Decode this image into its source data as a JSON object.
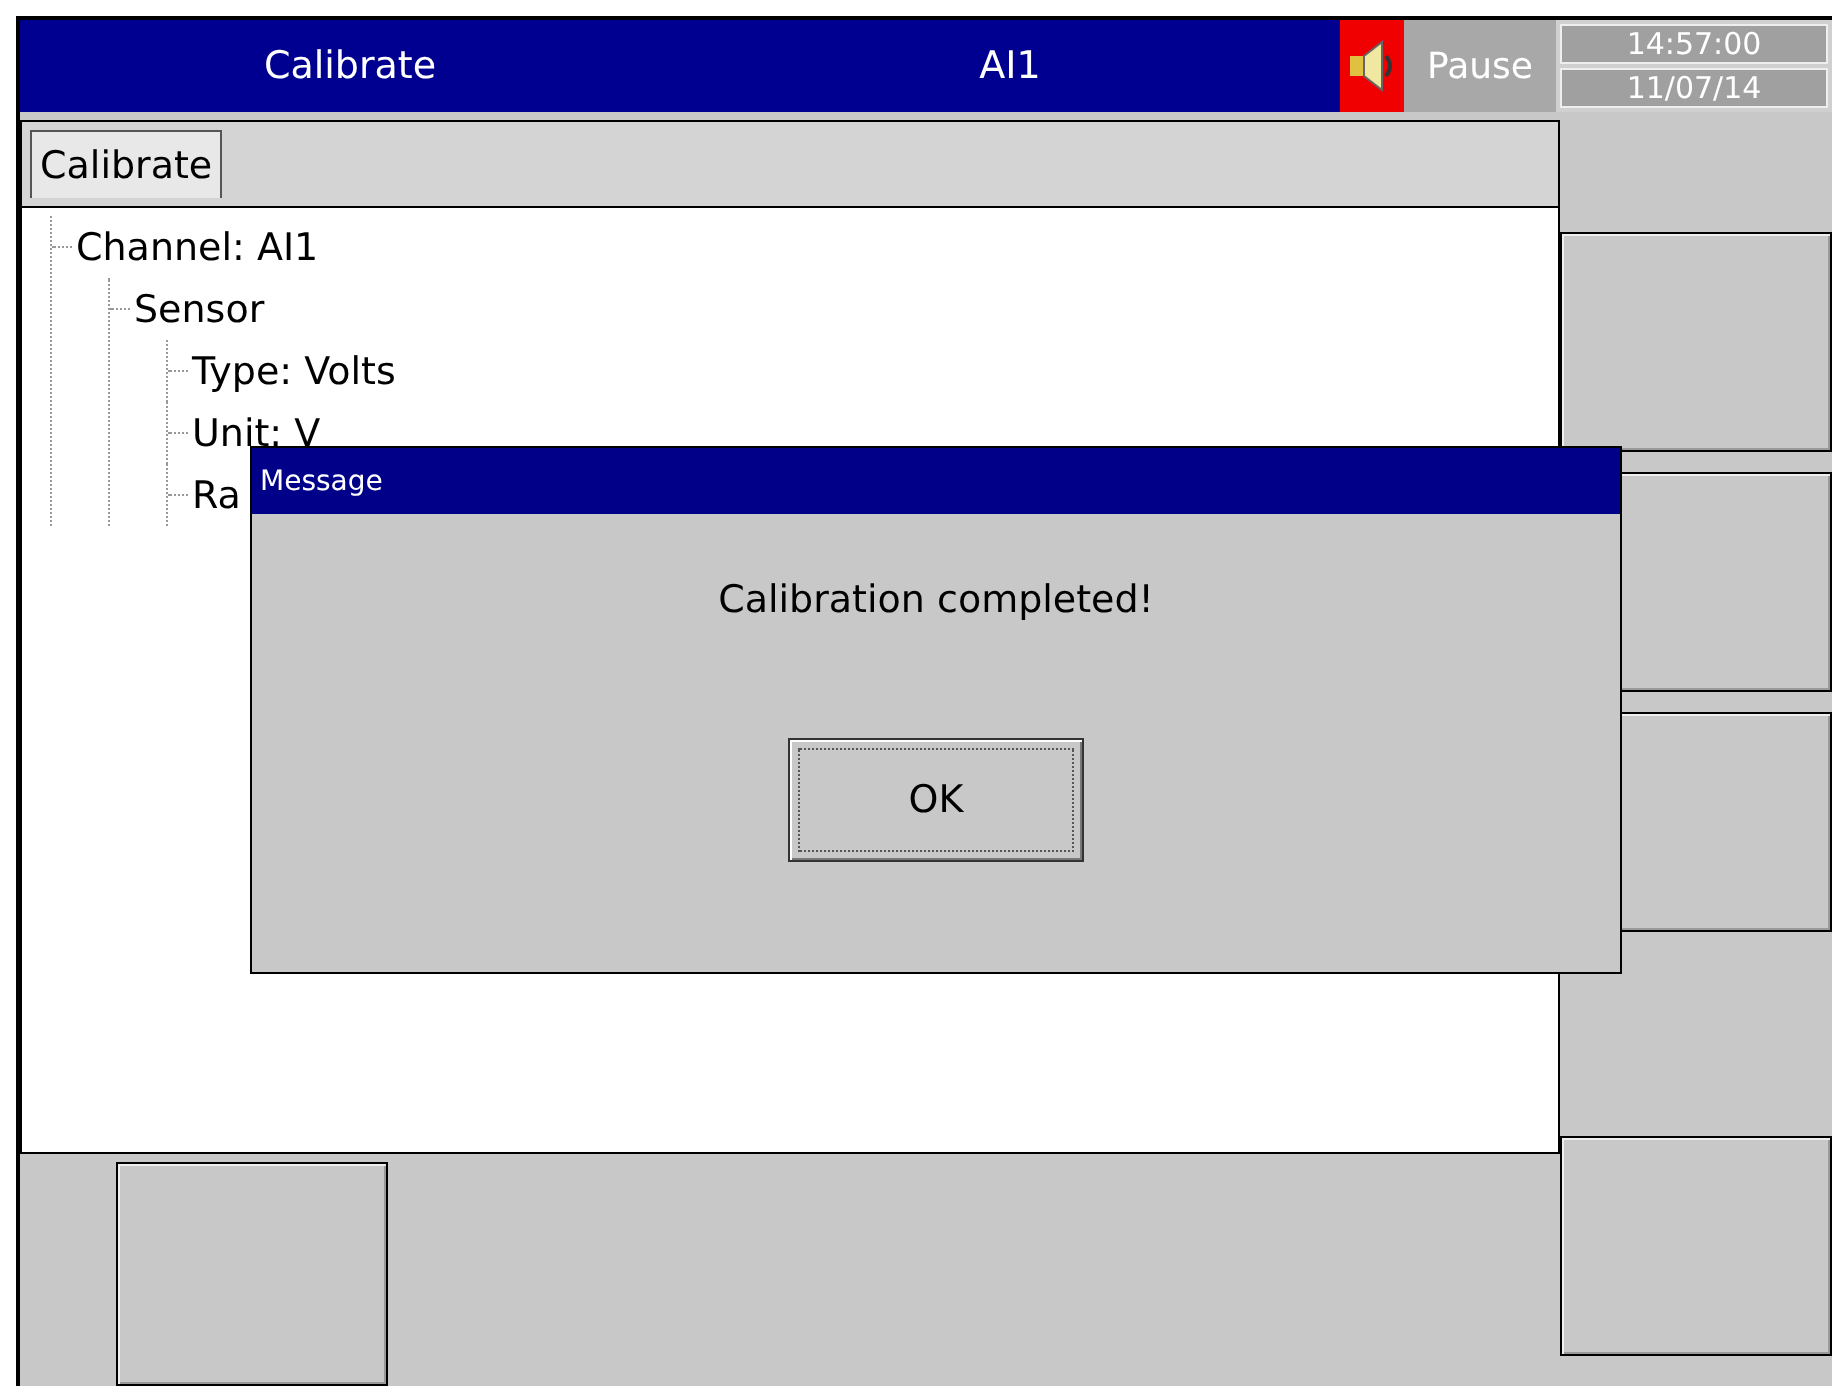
{
  "header": {
    "title": "Calibrate",
    "channel": "AI1",
    "alarm_on": true,
    "status": "Pause",
    "time": "14:57:00",
    "date": "11/07/14"
  },
  "tabs": [
    {
      "label": "Calibrate",
      "selected": true
    }
  ],
  "tree": [
    {
      "label": "Channel: AI1",
      "children": [
        {
          "label": "Sensor",
          "children": [
            {
              "label": "Type: Volts"
            },
            {
              "label": "Unit: V"
            },
            {
              "label": "Ra"
            }
          ]
        }
      ]
    }
  ],
  "dialog": {
    "title": "Message",
    "message": "Calibration completed!",
    "button": "OK"
  }
}
